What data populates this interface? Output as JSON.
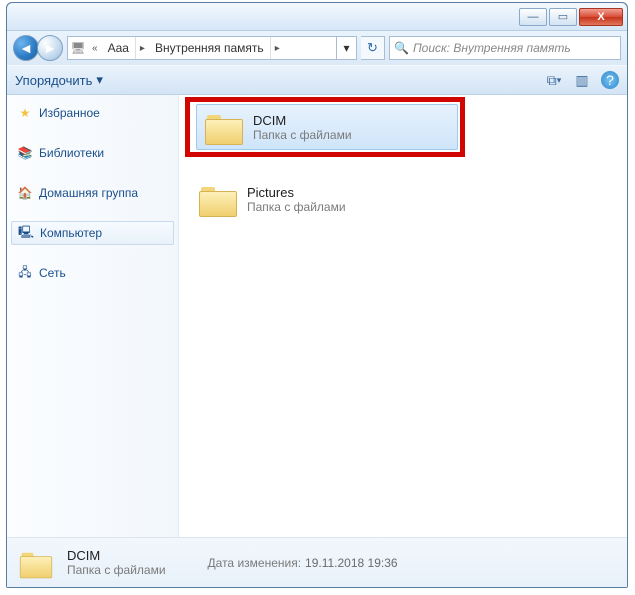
{
  "titlebar": {
    "minimize": "—",
    "maximize": "▭",
    "close": "X"
  },
  "nav": {
    "back_glyph": "◄",
    "fwd_glyph": "►",
    "refresh_glyph": "↻",
    "computer_glyph": "🖥",
    "dropdown_glyph": "▾"
  },
  "breadcrumb": {
    "seg1": "Aaa",
    "seg2": "Внутренняя память",
    "arrow": "▸"
  },
  "search": {
    "placeholder": "Поиск: Внутренняя память",
    "icon": "🔍"
  },
  "toolbar": {
    "organize": "Упорядочить",
    "organize_arrow": "▾",
    "view_icon": "⧉",
    "preview_icon": "▥",
    "help_icon": "?"
  },
  "sidebar": {
    "favorites_icon": "★",
    "favorites": "Избранное",
    "libraries_icon": "📚",
    "libraries": "Библиотеки",
    "homegroup_icon": "🏠",
    "homegroup": "Домашняя группа",
    "computer_icon": "🖳",
    "computer": "Компьютер",
    "network_icon": "🖧",
    "network": "Сеть"
  },
  "folders": [
    {
      "name": "DCIM",
      "sub": "Папка с файлами"
    },
    {
      "name": "Pictures",
      "sub": "Папка с файлами"
    }
  ],
  "details": {
    "name": "DCIM",
    "sub": "Папка с файлами",
    "modified_label": "Дата изменения:",
    "modified_value": "19.11.2018 19:36"
  }
}
